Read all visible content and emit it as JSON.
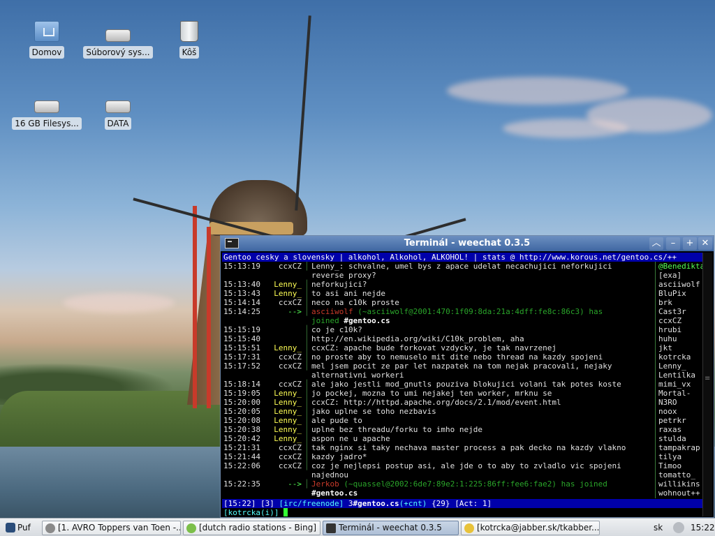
{
  "desktop": {
    "icons": [
      {
        "label": "Domov",
        "icon": "home-folder-icon"
      },
      {
        "label": "Súborový sys...",
        "icon": "drive-icon"
      },
      {
        "label": "Kôš",
        "icon": "trash-icon"
      },
      {
        "label": "16 GB Filesys...",
        "icon": "drive-icon"
      },
      {
        "label": "DATA",
        "icon": "drive-icon"
      }
    ]
  },
  "terminal": {
    "title": "Terminál - weechat 0.3.5",
    "topic": "Gentoo cesky a slovensky | alkohol, Alkohol, ALKOHOL! | stats @ http://www.korous.net/gentoo.cs/++",
    "lines": [
      {
        "time": "15:13:19",
        "nick": "ccxCZ",
        "text": "Lenny_: schvalne, umel bys z apace udelat necachujici neforkujici\nreverse proxy?"
      },
      {
        "time": "15:13:40",
        "nick": "Lenny_",
        "text": "neforkujici?"
      },
      {
        "time": "15:13:43",
        "nick": "Lenny_",
        "text": "to asi ani nejde"
      },
      {
        "time": "15:14:14",
        "nick": "ccxCZ",
        "text": "neco na c10k proste"
      },
      {
        "time": "15:14:25",
        "nick": "-->",
        "join_nick": "asciiwolf",
        "join_host": "(~asciiwolf@2001:470:1f09:8da:21a:4dff:fe8c:86c3)",
        "join_text": "has\njoined",
        "join_channel": "#gentoo.cs"
      },
      {
        "time": "15:15:19",
        "nick": "",
        "text": "co je c10k?"
      },
      {
        "time": "15:15:40",
        "nick": "",
        "text": "http://en.wikipedia.org/wiki/C10k_problem, aha"
      },
      {
        "time": "15:15:51",
        "nick": "Lenny_",
        "text": "ccxCZ: apache bude forkovat vzdycky, je tak navrzenej"
      },
      {
        "time": "15:17:31",
        "nick": "ccxCZ",
        "text": "no proste aby to nemuselo mit dite nebo thread na kazdy spojeni"
      },
      {
        "time": "15:17:52",
        "nick": "ccxCZ",
        "text": "mel jsem pocit ze par let nazpatek na tom nejak pracovali, nejaky\nalternativni workeri"
      },
      {
        "time": "15:18:14",
        "nick": "ccxCZ",
        "text": "ale jako jestli mod_gnutls pouziva blokujici volani tak potes koste"
      },
      {
        "time": "15:19:05",
        "nick": "Lenny_",
        "text": "jo pockej, mozna to umi nejakej ten worker, mrknu se"
      },
      {
        "time": "15:20:00",
        "nick": "Lenny_",
        "text": "ccxCZ: http://httpd.apache.org/docs/2.1/mod/event.html"
      },
      {
        "time": "15:20:05",
        "nick": "Lenny_",
        "text": "jako uplne se toho nezbavis"
      },
      {
        "time": "15:20:08",
        "nick": "Lenny_",
        "text": "ale pude to"
      },
      {
        "time": "15:20:38",
        "nick": "Lenny_",
        "text": "uplne bez threadu/forku to imho nejde"
      },
      {
        "time": "15:20:42",
        "nick": "Lenny_",
        "text": "aspon ne u apache"
      },
      {
        "time": "15:21:31",
        "nick": "ccxCZ",
        "text": "tak nginx si taky nechava master process a pak decko na kazdy vlakno"
      },
      {
        "time": "15:21:44",
        "nick": "ccxCZ",
        "text": "kazdy jadro*"
      },
      {
        "time": "15:22:06",
        "nick": "ccxCZ",
        "text": "coz je nejlepsi postup asi, ale jde o to aby to zvladlo vic spojeni\nnajednou"
      },
      {
        "time": "15:22:35",
        "nick": "-->",
        "join_nick": "Jerkob",
        "join_host": "(~quassel@2002:6de7:89e2:1:225:86ff:fee6:fae2)",
        "join_text": "has joined",
        "join_channel": "#gentoo.cs"
      }
    ],
    "nicklist": [
      "@Benedikta",
      "[exa]",
      "asciiwolf",
      "BluPix",
      "brk",
      "Cast3r",
      "ccxCZ",
      "hrubi",
      "huhu",
      "jkt",
      "kotrcka",
      "Lenny_",
      "Lentilka",
      "mimi_vx",
      "Mortal-",
      "N3RO",
      "noox",
      "petrkr",
      "raxas",
      "stulda",
      "tampakrap",
      "tilya",
      "Timoo",
      "tomatto_",
      "willikins",
      "wohnout++"
    ],
    "status": {
      "time": "[15:22]",
      "num": "[3]",
      "server": "[irc/freenode]",
      "win": "3",
      "channel": "#gentoo.cs",
      "mode": "(+cnt)",
      "count": "{29}",
      "act": "[Act: 1]"
    },
    "input": {
      "prefix": "[kotrcka(i)]"
    }
  },
  "taskbar": {
    "start_label": "Puf",
    "tasks": [
      {
        "label": "[1. AVRO Toppers van Toen -...",
        "icon_color": "#8a8a8a"
      },
      {
        "label": "[dutch radio stations - Bing]",
        "icon_color": "#7cbf4a"
      },
      {
        "label": "Terminál - weechat 0.3.5",
        "icon_color": "#333333"
      },
      {
        "label": "[kotrcka@jabber.sk/tkabber...",
        "icon_color": "#e8c23a"
      }
    ],
    "layout": "sk",
    "clock": "15:22"
  }
}
